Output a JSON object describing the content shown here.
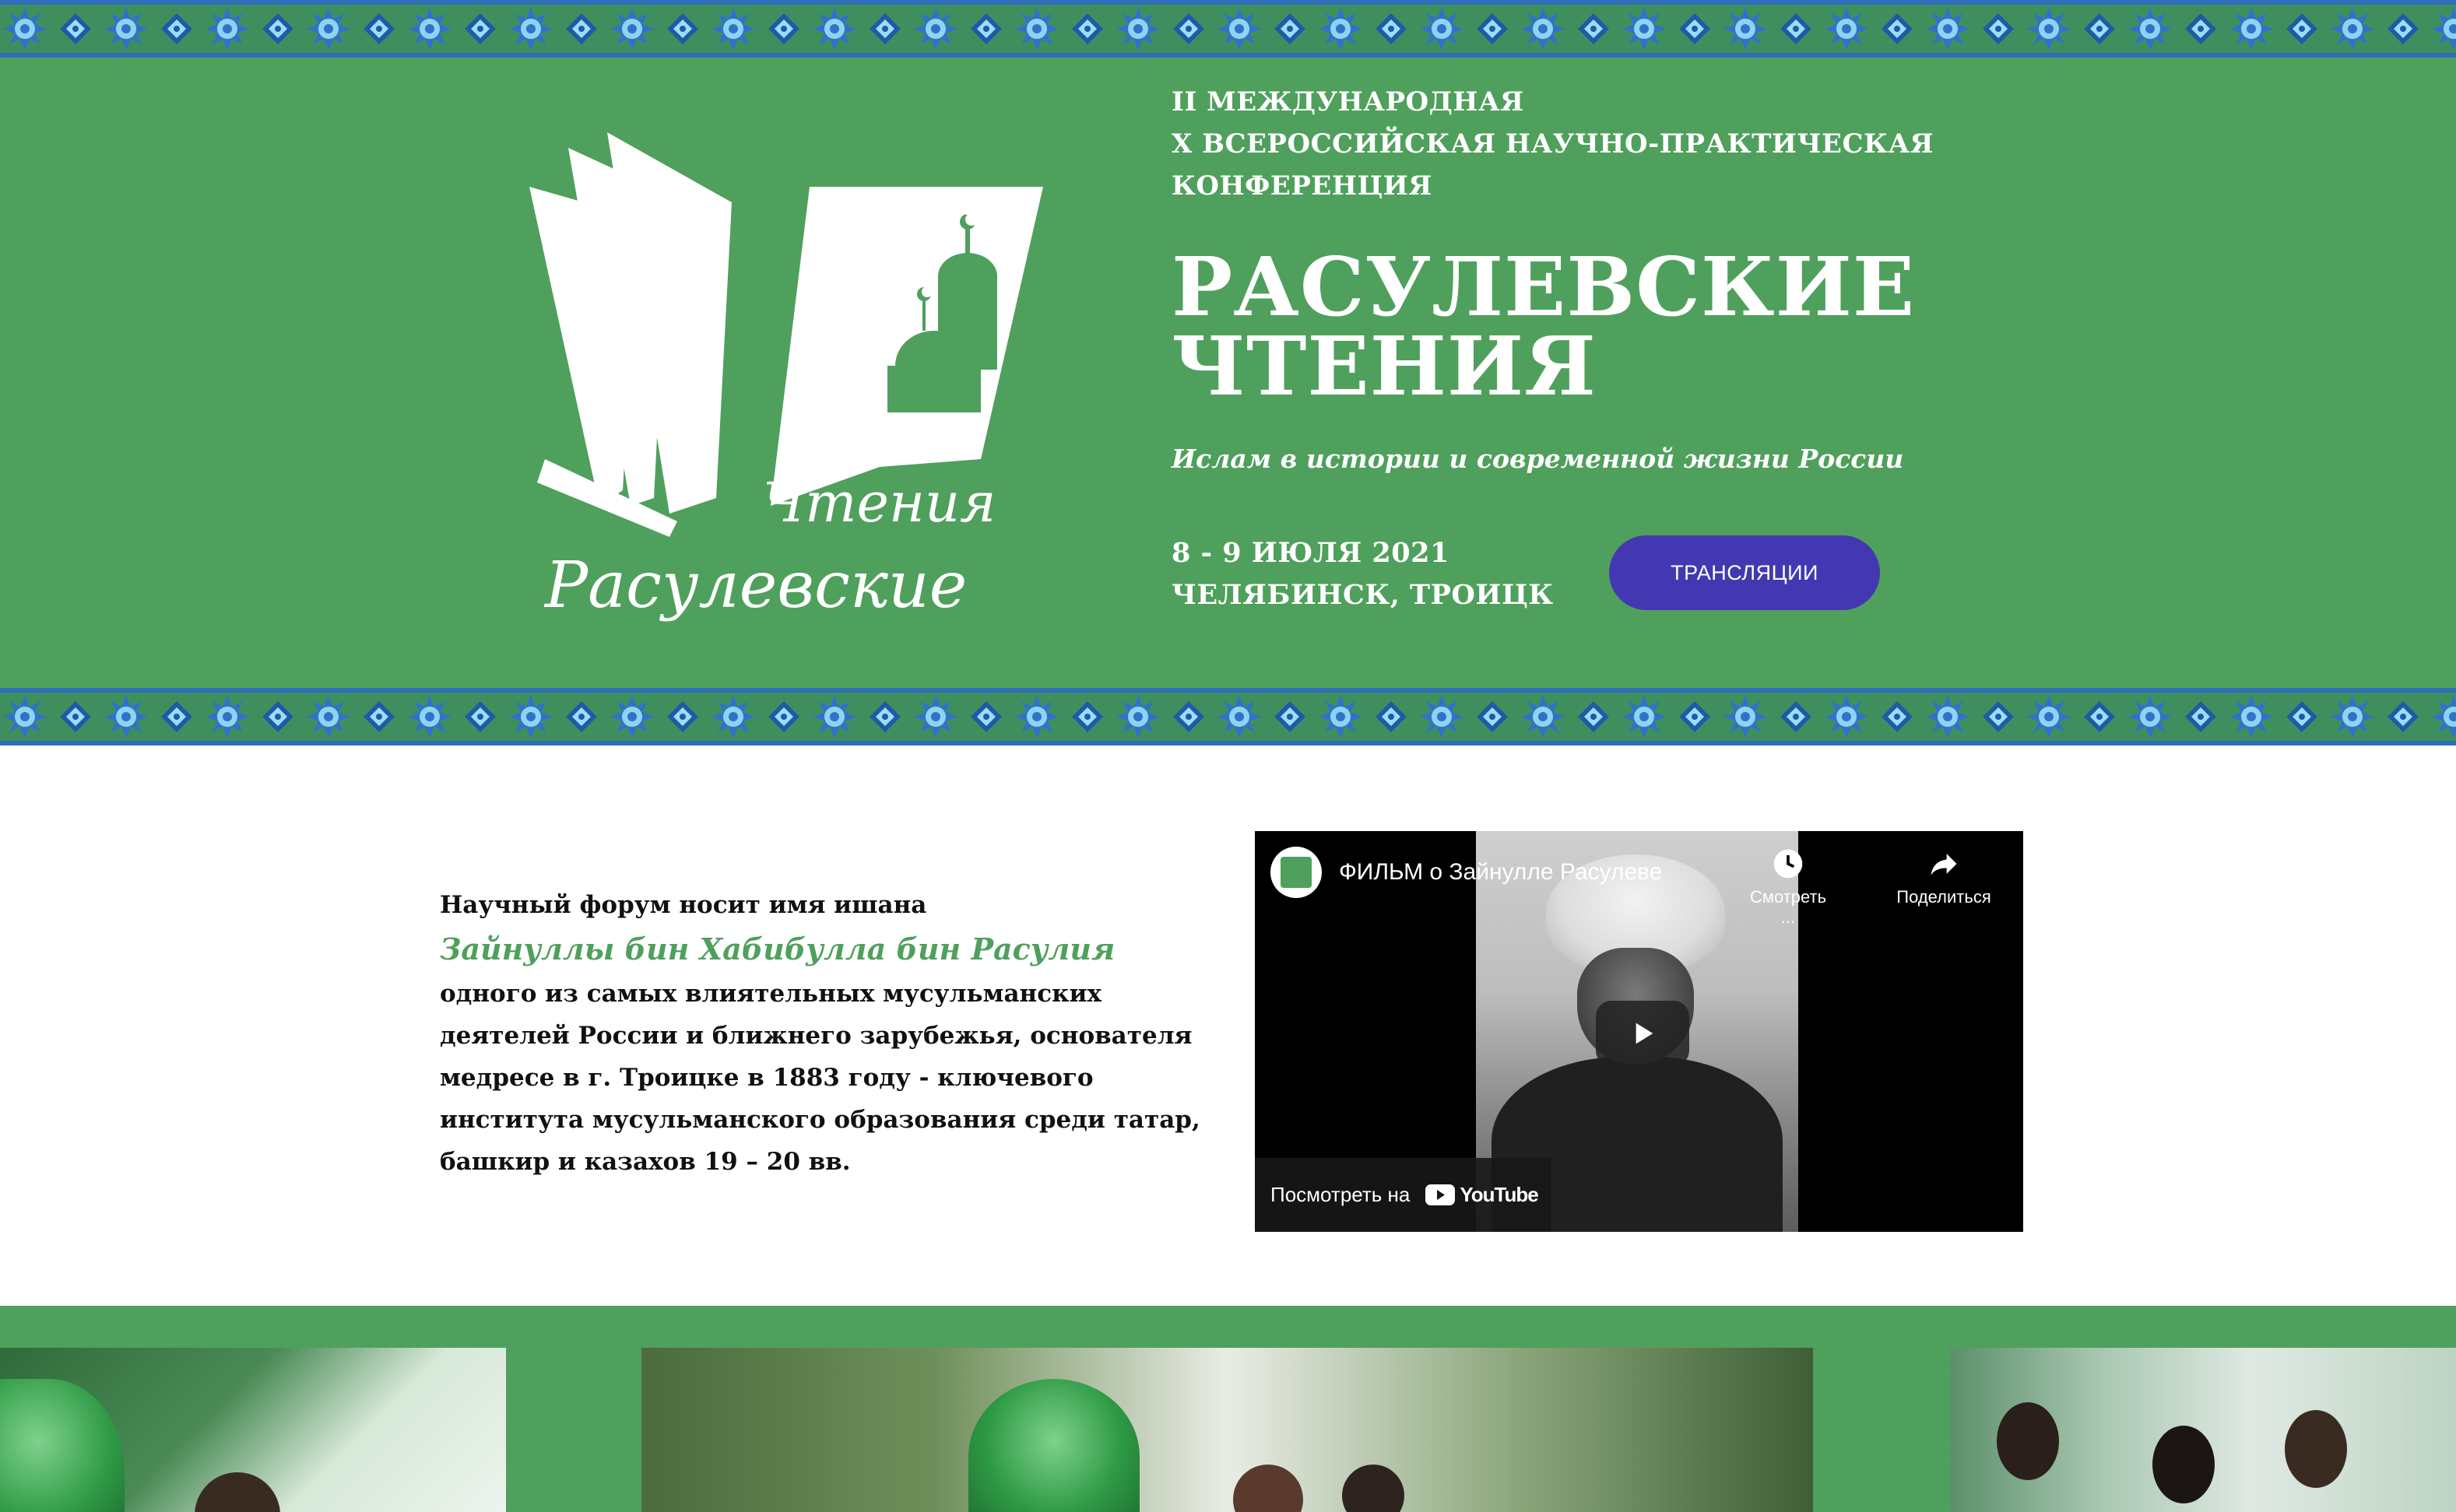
{
  "hero": {
    "conference_lines": [
      "II МЕЖДУНАРОДНАЯ",
      "X ВСЕРОССИЙСКАЯ НАУЧНО-ПРАКТИЧЕСКАЯ",
      "КОНФЕРЕНЦИЯ"
    ],
    "title_line1": "РАСУЛЕВСКИЕ",
    "title_line2": "ЧТЕНИЯ",
    "subtitle": "Ислам в истории и современной жизни России",
    "date": "8 - 9 ИЮЛЯ 2021",
    "location": "ЧЕЛЯБИНСК, ТРОИЦК",
    "broadcast_button": "ТРАНСЛЯЦИИ",
    "logo_text_top": "Чтения",
    "logo_text_bottom": "Расулевские"
  },
  "about": {
    "intro": "Научный форум носит имя ишана",
    "name": "Зайнуллы бин Хабибулла бин Расулия",
    "description": "одного из самых влиятельных мусульманских деятелей России и ближнего зарубежья, основателя медресе в г. Троицке в 1883 году - ключевого института мусульманского образования среди татар, башкир и казахов 19 – 20 вв."
  },
  "video": {
    "title": "ФИЛЬМ о Зайнулле Расулеве",
    "watch_later": "Смотреть ...",
    "share": "Поделиться",
    "watch_on": "Посмотреть на",
    "youtube_word": "YouTube"
  },
  "colors": {
    "brand_green": "#4fa05c",
    "button_purple": "#4438b2",
    "ornament_blue": "#2f73c9"
  }
}
